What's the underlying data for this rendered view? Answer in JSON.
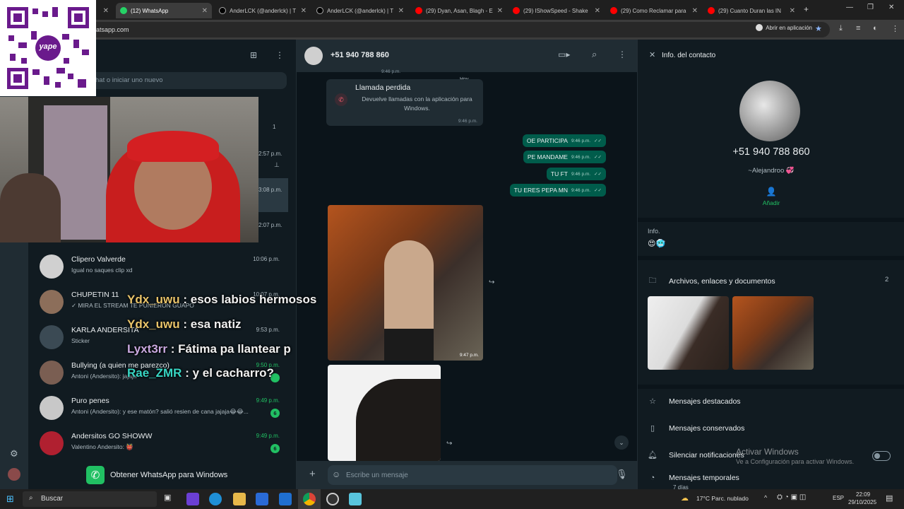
{
  "browser": {
    "tabs": [
      {
        "label": "",
        "active": false
      },
      {
        "label": "(12) WhatsApp",
        "active": true
      },
      {
        "label": "AnderLCK (@anderlck) | T",
        "active": false
      },
      {
        "label": "AnderLCK (@anderlck) | T",
        "active": false
      },
      {
        "label": "(29) Dyan, Asan, Blagh - E",
        "active": false
      },
      {
        "label": "(29) IShowSpeed - Shake",
        "active": false
      },
      {
        "label": "(29) Como Reclamar para",
        "active": false
      },
      {
        "label": "(29) Cuanto Duran las IN",
        "active": false
      }
    ],
    "url": "atsapp.com",
    "open_in_app": "Abrir en aplicación"
  },
  "qr": {
    "brand": "yape"
  },
  "left_pane": {
    "search_placeholder": "hat o iniciar uno nuevo",
    "partial_items": [
      {
        "time": "",
        "badge": "1"
      },
      {
        "time": "2:57 p.m.",
        "badge": ""
      },
      {
        "time": "3:08 p.m.",
        "badge": ""
      },
      {
        "time": "2:07 p.m.",
        "badge": ""
      }
    ],
    "chats": [
      {
        "name": "Clipero Valverde",
        "preview": "Igual no saques clip xd",
        "time": "10:06 p.m.",
        "badge": "",
        "green": false
      },
      {
        "name": "CHUPETIN 11",
        "preview": "✓ MIRA EL STREAM TE PUNIERON GUAPO",
        "time": "10:07 p.m.",
        "badge": "",
        "green": false
      },
      {
        "name": "KARLA ANDERSITA",
        "preview": "Sticker",
        "time": "9:53 p.m.",
        "badge": "",
        "green": false
      },
      {
        "name": "Bullying (a quien me parezco)",
        "preview": "Antoni (Andersito): jajaja",
        "time": "9:50 p.m.",
        "badge": "",
        "green": true
      },
      {
        "name": "Puro penes",
        "preview": "Antoni (Andersito): y ese matón? salió resien de cana jajaja😂😂...",
        "time": "9:49 p.m.",
        "badge": "6",
        "green": true
      },
      {
        "name": "Andersitos GO SHOWW",
        "preview": "Valentino Andersito: 👹",
        "time": "9:49 p.m.",
        "badge": "6",
        "green": true
      }
    ],
    "get_app": "Obtener WhatsApp para Windows"
  },
  "chat": {
    "contact": "+51 940 788 860",
    "top_time": "9:46 p.m.",
    "date_label": "Hoy",
    "missed_call": {
      "title": "Llamada perdida",
      "desc": "Devuelve llamadas con la aplicación para Windows.",
      "time": "9:46 p.m."
    },
    "messages": [
      {
        "text": "OE PARTICIPA",
        "time": "9:46 p.m."
      },
      {
        "text": "PE MANDAME",
        "time": "9:46 p.m."
      },
      {
        "text": "TU FT",
        "time": "9:46 p.m."
      },
      {
        "text": "TU ERES PEPA MN",
        "time": "9:46 p.m."
      }
    ],
    "photo_time": "9:47 p.m.",
    "composer_placeholder": "Escribe un mensaje"
  },
  "info": {
    "title": "Info. del contacto",
    "phone": "+51 940 788 860",
    "name": "~Alejandroo 💞",
    "add": "Añadir",
    "about_label": "Info.",
    "about": "😍🥶",
    "files_label": "Archivos, enlaces y documentos",
    "files_count": "2",
    "rows": [
      "Mensajes destacados",
      "Mensajes conservados",
      "Silenciar notificaciones",
      "Mensajes temporales"
    ],
    "temp_sub": "7 días"
  },
  "stream_chat": [
    {
      "user": "Ydx_uwu",
      "msg": "esos labios hermosos",
      "color": "#e9c46a"
    },
    {
      "user": "Ydx_uwu",
      "msg": "esa natiz",
      "color": "#e9c46a"
    },
    {
      "user": "Lyxt3rr",
      "msg": "Fátima pa llantear p",
      "color": "#c9a9e0"
    },
    {
      "user": "Rae_ZMR",
      "msg": "y el cacharro?",
      "color": "#38d6c4"
    }
  ],
  "windows": {
    "activate_title": "Activar Windows",
    "activate_sub": "Ve a Configuración para activar Windows."
  },
  "taskbar": {
    "search": "Buscar",
    "weather": "17°C  Parc. nublado",
    "lang": "ESP",
    "time": "22:09",
    "date": "29/10/2025"
  }
}
